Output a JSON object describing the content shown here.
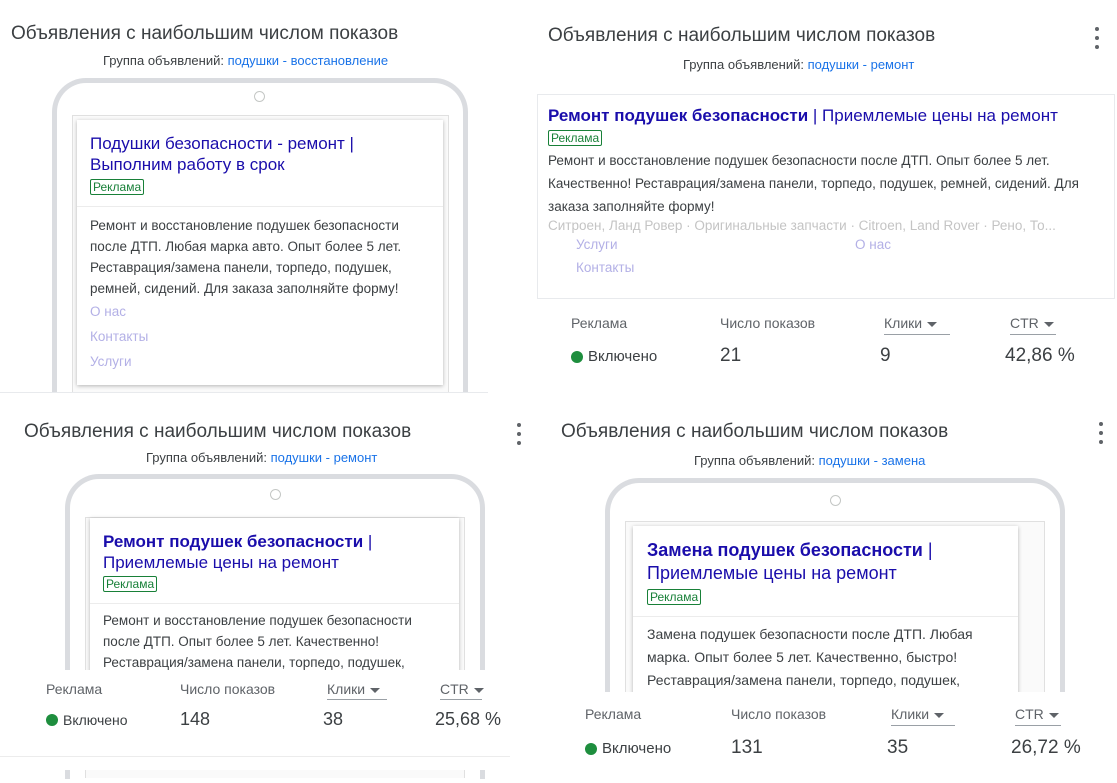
{
  "colors": {
    "accent": "#1a73e8",
    "ad_title": "#1a0dab",
    "ad_badge": "#188038",
    "status_green": "#1e8e3e"
  },
  "panels": [
    {
      "title": "Объявления с наибольшим числом показов",
      "group_label": "Группа объявлений:",
      "group_name": "подушки - восстановление",
      "ad": {
        "headline_1": "Подушки безопасности - ремонт |",
        "headline_2": "Выполним работу в срок",
        "badge": "Реклама",
        "description": "Ремонт и восстановление подушек безопасности после ДТП. Любая марка авто. Опыт более 5 лет. Реставрация/замена панели, торпедо, подушек, ремней, сидений. Для заказа заполняйте форму!",
        "sitelinks": [
          "О нас",
          "Контакты",
          "Услуги"
        ]
      }
    },
    {
      "title": "Объявления с наибольшим числом показов",
      "group_label": "Группа объявлений:",
      "group_name": "подушки - ремонт",
      "ad": {
        "headline_bold": "Ремонт подушек безопасности",
        "separator": "|",
        "headline_rest": "Приемлемые цены на ремонт",
        "badge": "Реклама",
        "description": "Ремонт и восстановление подушек безопасности после ДТП. Опыт более 5 лет. Качественно! Реставрация/замена панели, торпедо, подушек, ремней, сидений. Для заказа заполняйте форму!",
        "snippet": "Ситроен, Ланд Ровер · Оригинальные запчасти · Citroen, Land Rover · Рено, То...",
        "sitelinks": [
          "Услуги",
          "О нас",
          "Контакты"
        ]
      },
      "stats": {
        "col_ad": "Реклама",
        "col_impr": "Число показов",
        "col_clicks": "Клики",
        "col_ctr": "CTR",
        "status": "Включено",
        "impressions": "21",
        "clicks": "9",
        "ctr": "42,86 %"
      }
    },
    {
      "title": "Объявления с наибольшим числом показов",
      "group_label": "Группа объявлений:",
      "group_name": "подушки - ремонт",
      "ad": {
        "headline_bold": "Ремонт подушек безопасности",
        "separator": "|",
        "headline_rest": "Приемлемые цены на ремонт",
        "badge": "Реклама",
        "description": "Ремонт и восстановление подушек безопасности после ДТП. Опыт более 5 лет. Качественно! Реставрация/замена панели, торпедо, подушек,"
      },
      "stats": {
        "col_ad": "Реклама",
        "col_impr": "Число показов",
        "col_clicks": "Клики",
        "col_ctr": "CTR",
        "status": "Включено",
        "impressions": "148",
        "clicks": "38",
        "ctr": "25,68 %"
      }
    },
    {
      "title": "Объявления с наибольшим числом показов",
      "group_label": "Группа объявлений:",
      "group_name": "подушки - замена",
      "ad": {
        "headline_bold": "Замена подушек безопасности",
        "separator": "|",
        "headline_rest": "Приемлемые цены на ремонт",
        "badge": "Реклама",
        "description": "Замена подушек безопасности после ДТП. Любая марка. Опыт более 5 лет. Качественно, быстро! Реставрация/замена панели, торпедо, подушек,"
      },
      "stats": {
        "col_ad": "Реклама",
        "col_impr": "Число показов",
        "col_clicks": "Клики",
        "col_ctr": "CTR",
        "status": "Включено",
        "impressions": "131",
        "clicks": "35",
        "ctr": "26,72 %"
      }
    }
  ]
}
